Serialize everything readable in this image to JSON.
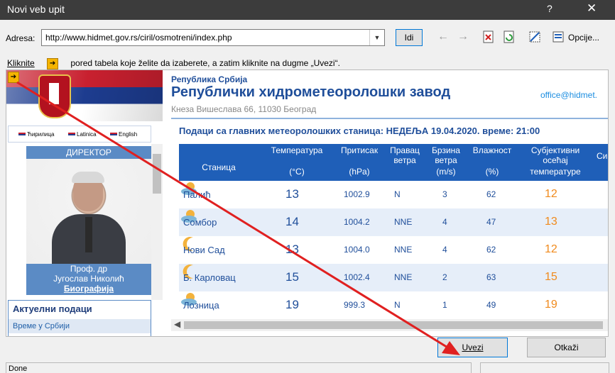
{
  "window": {
    "title": "Novi veb upit",
    "help_label": "?",
    "close_label": "✕"
  },
  "address": {
    "label": "Adresa:",
    "value": "http://www.hidmet.gov.rs/ciril/osmotreni/index.php",
    "go_label": "Idi",
    "options_label": "Opcije..."
  },
  "hint": {
    "before": "Kliknite",
    "after": "pored tabela koje želite da izaberete, a zatim kliknite na dugme „Uvezi“."
  },
  "site": {
    "republic": "Република Србија",
    "institute": "Републички хидрометеоролошки завод",
    "address": "Кнеза Вишеслава 66, 11030 Београд",
    "email": "office@hidmet.",
    "languages": [
      "Ћирилица",
      "Latinica",
      "English"
    ],
    "director": {
      "heading": "ДИРЕКТОР",
      "title": "Проф. др",
      "name": "Југослав Николић",
      "bio": "Биографија"
    },
    "current": {
      "heading": "Актуелни подаци",
      "item": "Време у Србији"
    }
  },
  "table": {
    "caption": "Подаци са главних метеоролошких станица:  НЕДЕЉА 19.04.2020.  време: 21:00",
    "headers": {
      "station": "Станица",
      "temp": "Температура",
      "temp_unit": "(°C)",
      "press": "Притисак",
      "press_unit": "(hPa)",
      "wdir": "Правац",
      "wdir2": "ветра",
      "wspd": "Брзина",
      "wspd2": "ветра",
      "wspd_unit": "(m/s)",
      "hum": "Влажност",
      "hum_unit": "(%)",
      "feel": "Субјективни",
      "feel2": "осећај",
      "feel3": "температуре",
      "sym": "Сим"
    },
    "rows": [
      {
        "station": "Палић",
        "temp": "13",
        "press": "1002.9",
        "wdir": "N",
        "wspd": "3",
        "hum": "62",
        "feel": "12",
        "icon": "cloud-icon"
      },
      {
        "station": "Сомбор",
        "temp": "14",
        "press": "1004.2",
        "wdir": "NNE",
        "wspd": "4",
        "hum": "47",
        "feel": "13",
        "icon": "cloud-icon"
      },
      {
        "station": "Нови Сад",
        "temp": "13",
        "press": "1004.0",
        "wdir": "NNE",
        "wspd": "4",
        "hum": "62",
        "feel": "12",
        "icon": "moon-icon"
      },
      {
        "station": "Б. Карловац",
        "temp": "15",
        "press": "1002.4",
        "wdir": "NNE",
        "wspd": "2",
        "hum": "63",
        "feel": "15",
        "icon": "moon-icon"
      },
      {
        "station": "Лозница",
        "temp": "19",
        "press": "999.3",
        "wdir": "N",
        "wspd": "1",
        "hum": "49",
        "feel": "19",
        "icon": "cloud-icon"
      }
    ]
  },
  "buttons": {
    "import": "Uvezi",
    "cancel": "Otkaži"
  },
  "status": {
    "text": "Done"
  },
  "colors": {
    "header_blue": "#1f5fb8",
    "link_blue": "#1f4e9a",
    "feel_orange": "#f08a1c",
    "annotation_red": "#e02020"
  }
}
